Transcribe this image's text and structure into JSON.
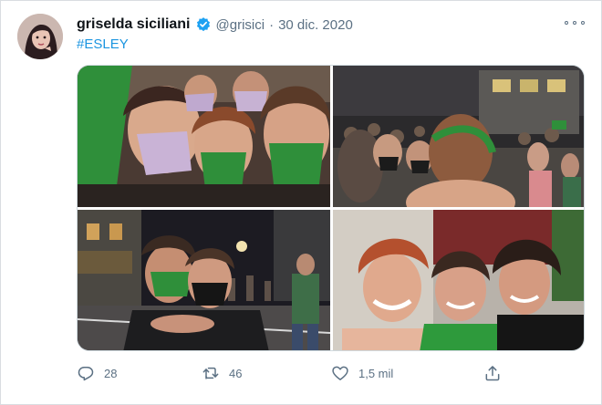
{
  "tweet": {
    "author_name": "griselda siciliani",
    "handle": "@grisici",
    "separator": "·",
    "date": "30 dic. 2020",
    "hashtag": "#ESLEY",
    "verified": true
  },
  "icons": {
    "verified": "verified-badge-icon",
    "more": "more-options-icon",
    "reply": "reply-icon",
    "retweet": "retweet-icon",
    "like": "heart-icon",
    "share": "share-icon"
  },
  "media": {
    "count": 4,
    "items": [
      {
        "description": "selfie group with green scarves"
      },
      {
        "description": "crowd on street at night"
      },
      {
        "description": "two women hugging on street"
      },
      {
        "description": "three women laughing"
      }
    ]
  },
  "actions": {
    "replies": "28",
    "retweets": "46",
    "likes": "1,5 mil"
  },
  "colors": {
    "link": "#1b95e0",
    "secondary_text": "#5b7083",
    "verified_blue": "#1da1f2",
    "campaign_green": "#2f8f3a"
  }
}
